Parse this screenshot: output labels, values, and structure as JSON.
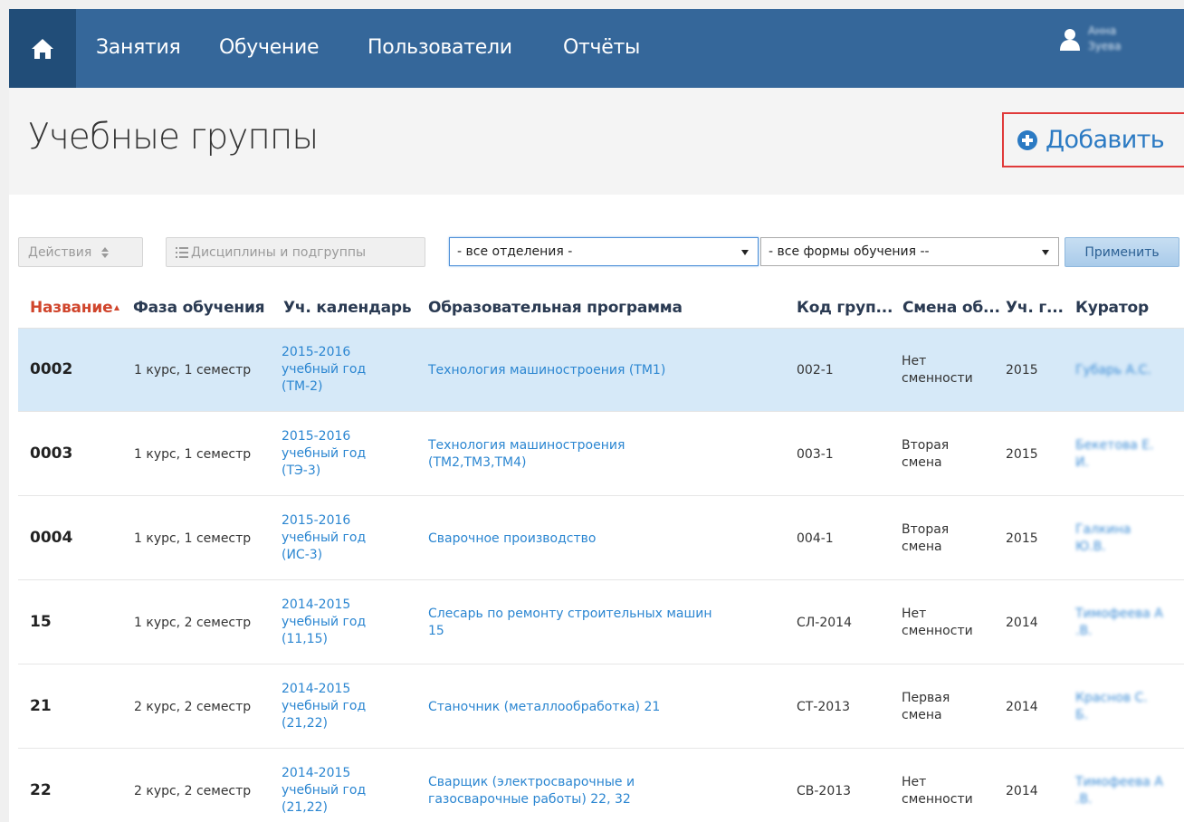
{
  "nav": {
    "items": [
      "Занятия",
      "Обучение",
      "Пользователи",
      "Отчёты"
    ],
    "user": {
      "first": "Анна",
      "last": "Зуева"
    }
  },
  "header": {
    "title": "Учебные группы",
    "add_label": "Добавить"
  },
  "toolbar": {
    "actions_label": "Действия",
    "disciplines_label": "Дисциплины и подгруппы",
    "department_select": "- все отделения -",
    "form_select": "- все формы обучения --",
    "apply_label": "Применить"
  },
  "table": {
    "columns": [
      "Название",
      "Фаза обучения",
      "Уч. календарь",
      "Образовательная программа",
      "Код груп...",
      "Смена об...",
      "Уч. г...",
      "Куратор"
    ],
    "rows": [
      {
        "name": "0002",
        "phase": "1 курс, 1 семестр",
        "calendar": [
          "2015-2016",
          "учебный год",
          "(ТМ-2)"
        ],
        "program": [
          "Технология машиностроения (ТМ1)"
        ],
        "code": "002-1",
        "shift": [
          "Нет",
          "сменности"
        ],
        "year": "2015",
        "curator": [
          "Губарь А.С."
        ]
      },
      {
        "name": "0003",
        "phase": "1 курс, 1 семестр",
        "calendar": [
          "2015-2016",
          "учебный год",
          "(ТЭ-3)"
        ],
        "program": [
          "Технология машиностроения",
          "(ТМ2,ТМ3,ТМ4)"
        ],
        "code": "003-1",
        "shift": [
          "Вторая",
          "смена"
        ],
        "year": "2015",
        "curator": [
          "Бекетова Е.",
          "И."
        ]
      },
      {
        "name": "0004",
        "phase": "1 курс, 1 семестр",
        "calendar": [
          "2015-2016",
          "учебный год",
          "(ИС-3)"
        ],
        "program": [
          "Сварочное производство"
        ],
        "code": "004-1",
        "shift": [
          "Вторая",
          "смена"
        ],
        "year": "2015",
        "curator": [
          "Галкина",
          "Ю.В."
        ]
      },
      {
        "name": "15",
        "phase": "1 курс, 2 семестр",
        "calendar": [
          "2014-2015",
          "учебный год",
          "(11,15)"
        ],
        "program": [
          "Слесарь по ремонту строительных машин",
          "15"
        ],
        "code": "СЛ-2014",
        "shift": [
          "Нет",
          "сменности"
        ],
        "year": "2014",
        "curator": [
          "Тимофеева А",
          ".В."
        ]
      },
      {
        "name": "21",
        "phase": "2 курс, 2 семестр",
        "calendar": [
          "2014-2015",
          "учебный год",
          "(21,22)"
        ],
        "program": [
          "Станочник (металлообработка) 21"
        ],
        "code": "СТ-2013",
        "shift": [
          "Первая",
          "смена"
        ],
        "year": "2014",
        "curator": [
          "Краснов С.",
          "Б."
        ]
      },
      {
        "name": "22",
        "phase": "2 курс, 2 семестр",
        "calendar": [
          "2014-2015",
          "учебный год",
          "(21,22)"
        ],
        "program": [
          "Сварщик (электросварочные и",
          "газосварочные работы) 22, 32"
        ],
        "code": "СВ-2013",
        "shift": [
          "Нет",
          "сменности"
        ],
        "year": "2014",
        "curator": [
          "Тимофеева А",
          ".В."
        ]
      }
    ]
  },
  "colors": {
    "nav_bg": "#35679a",
    "home_bg": "#214d78",
    "link": "#2b86d1",
    "selected_row": "#d6e9f8",
    "sorted_header": "#d0452c"
  }
}
